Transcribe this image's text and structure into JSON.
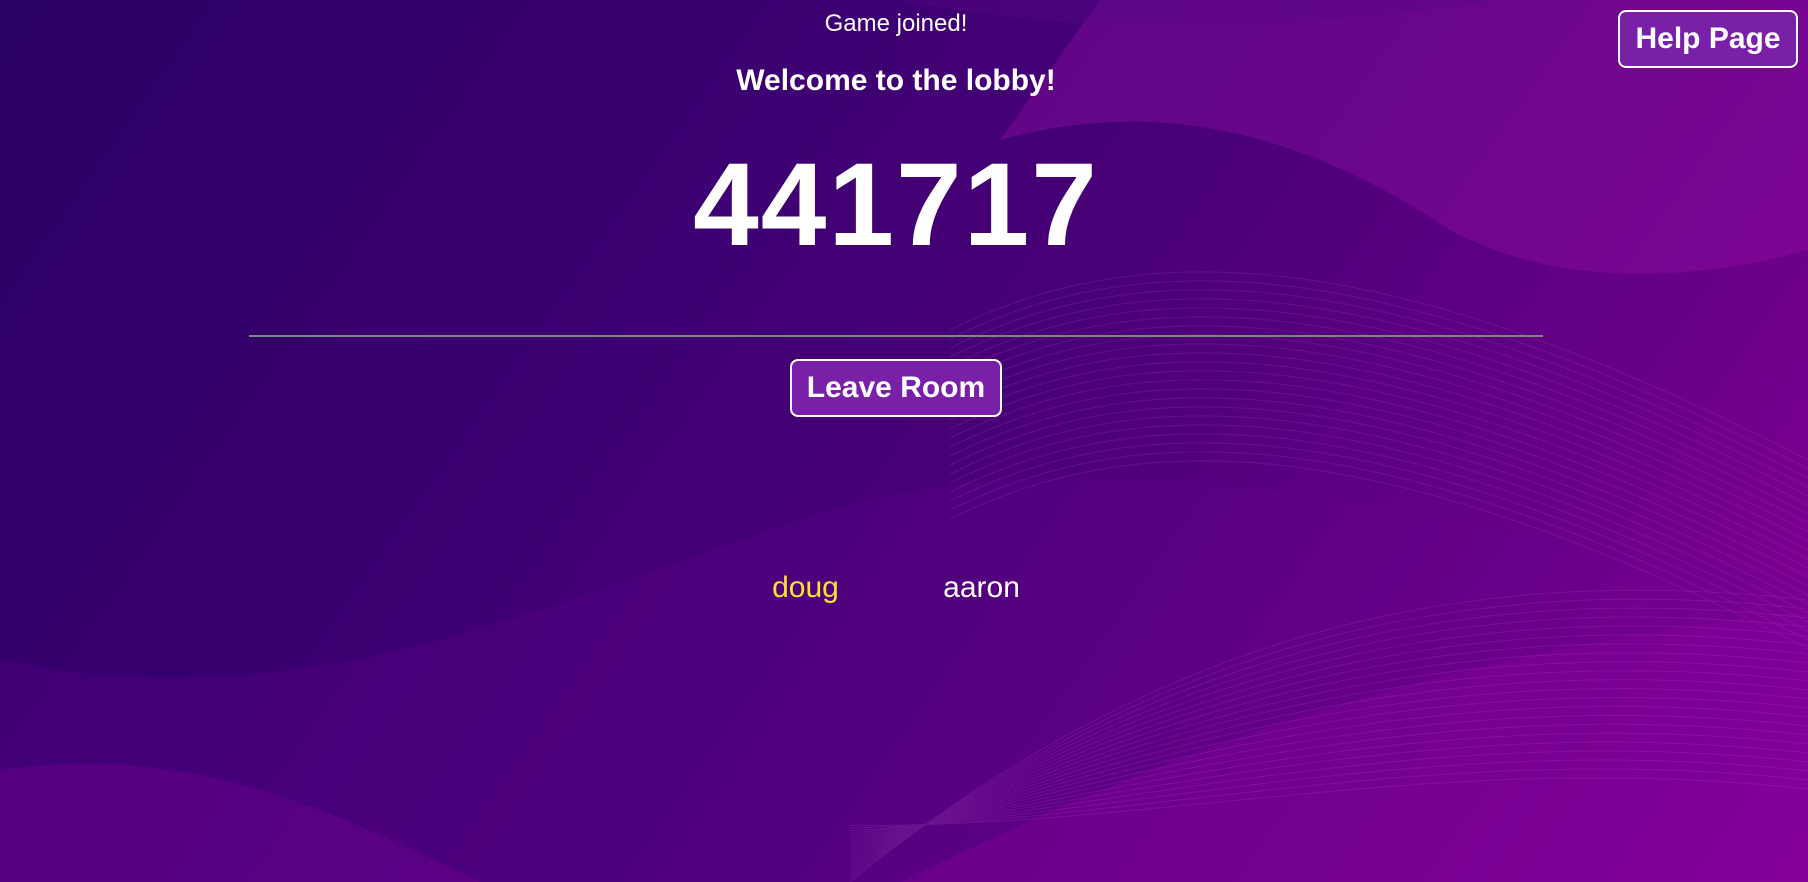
{
  "lobby": {
    "status": "Game joined!",
    "welcome": "Welcome to the lobby!",
    "room_code": "441717",
    "leave_label": "Leave Room",
    "help_label": "Help Page"
  },
  "players": [
    {
      "name": "doug",
      "color": "#ffe033"
    },
    {
      "name": "aaron",
      "color": "#ffffff"
    }
  ],
  "colors": {
    "background_dark": "#2a0063",
    "background_light": "#8a0098",
    "button_fill": "#7a1fa8",
    "divider": "#7a8a7a",
    "highlight_player": "#ffe033"
  }
}
